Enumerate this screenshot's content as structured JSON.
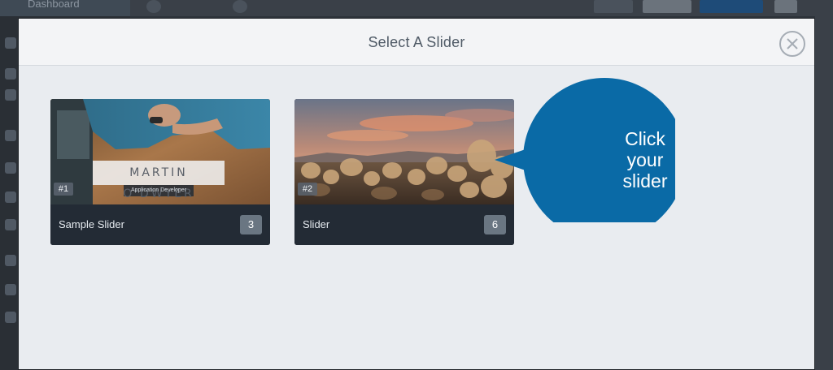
{
  "background": {
    "sidebar_item": "Dashboard"
  },
  "modal": {
    "title": "Select A Slider"
  },
  "sliders": [
    {
      "number": "#1",
      "name": "Sample Slider",
      "count": "3",
      "thumb_text": "MARTIN O'DWYER",
      "thumb_subtext": "Application Developer"
    },
    {
      "number": "#2",
      "name": "Slider",
      "count": "6"
    }
  ],
  "callout": {
    "line1": "Click",
    "line2": "your",
    "line3": "slider",
    "color": "#0a6aa6"
  }
}
